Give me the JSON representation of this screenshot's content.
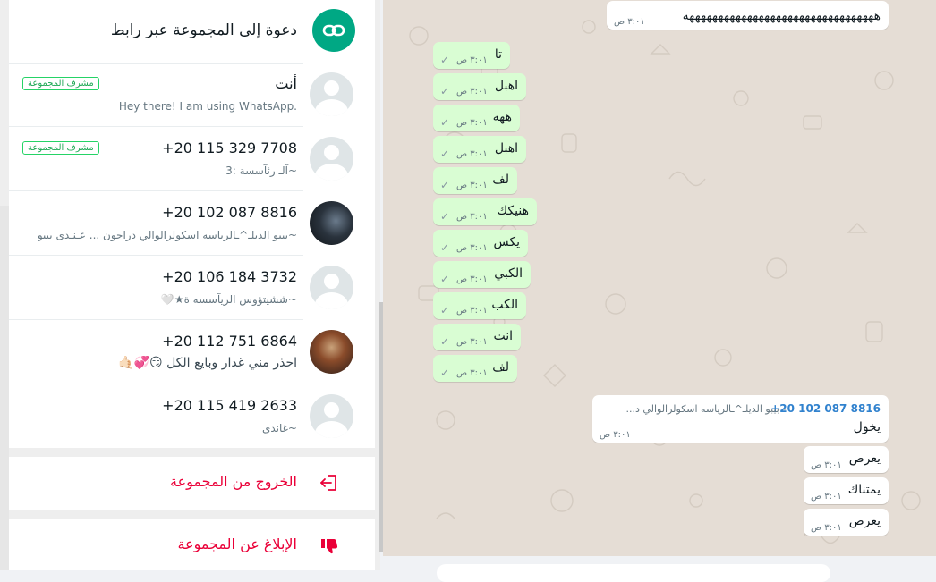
{
  "invite": {
    "label": "دعوة إلى المجموعة عبر رابط"
  },
  "members": [
    {
      "name": "أنت",
      "status": "Hey there! I am using WhatsApp.",
      "badge": "مشرف المجموعة"
    },
    {
      "name": "+20 115 329 7708",
      "status": "~آلـ رئآسسة :3",
      "badge": "مشرف المجموعة"
    },
    {
      "name": "+20 102 087 8816",
      "status": "~بيبو الديلـ^ـالرياسه اسكولرالوالي دراجون ... عـنـدى بيبو"
    },
    {
      "name": "+20 106 184 3732",
      "status": "~ششيتؤوس الريآسسه ة★🤍"
    },
    {
      "name": "+20 112 751 6864",
      "status": "احذر مني غدار وبايع الكل 😏💞🤙🏻"
    },
    {
      "name": "+20 115 419 2633",
      "status": "~غاندي"
    }
  ],
  "actions": {
    "exit_label": "الخروج من المجموعة",
    "report_label": "الإبلاغ عن المجموعة"
  },
  "chat": {
    "top_message": {
      "text": "هههههههههههههههههههههههههههههههههه",
      "time": "٣:٠١ ص"
    },
    "sent": [
      {
        "text": "تا",
        "time": "٣:٠١ ص"
      },
      {
        "text": "اهبل",
        "time": "٣:٠١ ص"
      },
      {
        "text": "ههه",
        "time": "٣:٠١ ص"
      },
      {
        "text": "اهبل",
        "time": "٣:٠١ ص"
      },
      {
        "text": "لف",
        "time": "٣:٠١ ص"
      },
      {
        "text": "هنيكك",
        "time": "٣:٠١ ص"
      },
      {
        "text": "يكس",
        "time": "٣:٠١ ص"
      },
      {
        "text": "الكبي",
        "time": "٣:٠١ ص"
      },
      {
        "text": "الكب",
        "time": "٣:٠١ ص"
      },
      {
        "text": "انت",
        "time": "٣:٠١ ص"
      },
      {
        "text": "لف",
        "time": "٣:٠١ ص"
      }
    ],
    "received_header": {
      "sender": "+20 102 087 8816",
      "sender_alias": "~بيبو الديلـ^ـالرياسه اسكولرالوالي د...",
      "text": "يخول",
      "time": "٣:٠١ ص"
    },
    "received": [
      {
        "text": "يعرص",
        "time": "٣:٠١ ص"
      },
      {
        "text": "يمتناك",
        "time": "٣:٠١ ص"
      },
      {
        "text": "يعرص",
        "time": "٣:٠١ ص"
      }
    ]
  },
  "colors": {
    "accent": "#00a884",
    "danger": "#ea0038",
    "sent_bubble": "#d9fdd3",
    "chat_bg": "#e5ddd5"
  }
}
